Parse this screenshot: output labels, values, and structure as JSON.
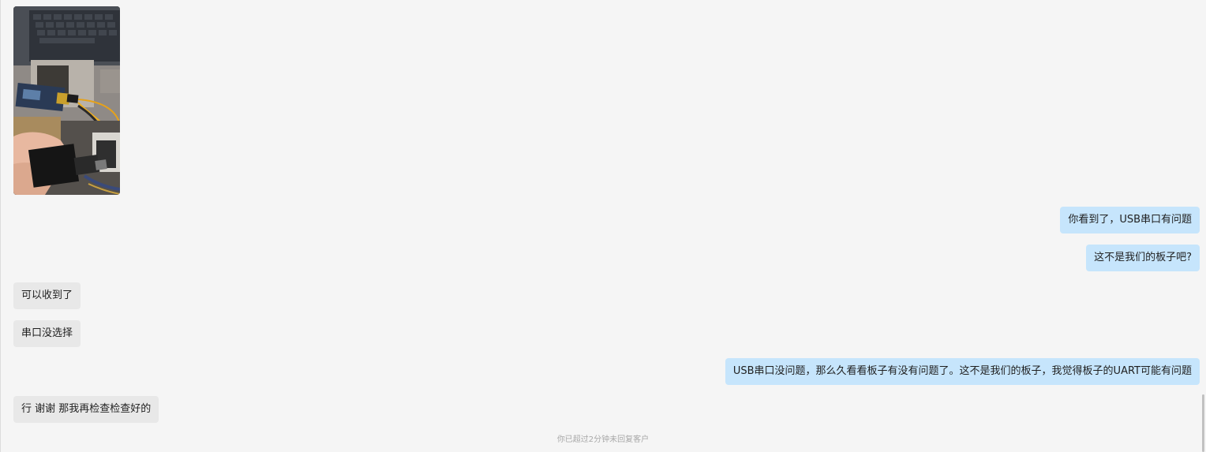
{
  "messages": [
    {
      "direction": "incoming",
      "type": "image",
      "image": "photo-usb-serial-adapter"
    },
    {
      "direction": "outgoing",
      "type": "text",
      "text": "你看到了，USB串口有问题"
    },
    {
      "direction": "outgoing",
      "type": "text",
      "text": "这不是我们的板子吧?"
    },
    {
      "direction": "incoming",
      "type": "text",
      "text": "可以收到了"
    },
    {
      "direction": "incoming",
      "type": "text",
      "text": "串口没选择"
    },
    {
      "direction": "outgoing",
      "type": "text",
      "text": "USB串口没问题，那么久看看板子有没有问题了。这不是我们的板子，我觉得板子的UART可能有问题"
    },
    {
      "direction": "incoming",
      "type": "text",
      "text": "行 谢谢 那我再检查检查好的"
    }
  ],
  "system_note": "你已超过2分钟未回复客户",
  "colors": {
    "background": "#f5f5f5",
    "outgoing_bubble": "#c6e5fc",
    "incoming_bubble": "#e8e8e8",
    "system_text": "#a8a8a8"
  }
}
